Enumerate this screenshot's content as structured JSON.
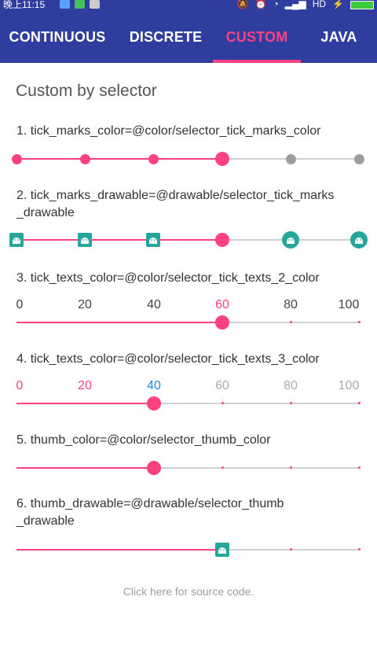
{
  "status_bar": {
    "time": "晚上11:15",
    "network": "HD"
  },
  "tabs": [
    {
      "label": "CONTINUOUS"
    },
    {
      "label": "DISCRETE"
    },
    {
      "label": "CUSTOM",
      "active": true
    },
    {
      "label": "JAVA"
    }
  ],
  "heading": "Custom by selector",
  "rows": [
    {
      "title": "1. tick_marks_color=@color/selector_tick_marks_color",
      "progress": 60
    },
    {
      "title_line1": "2. tick_marks_drawable=@drawable/selector_tick_marks",
      "title_line2": "_drawable",
      "progress": 60
    },
    {
      "title": "3. tick_texts_color=@color/selector_tick_texts_2_color",
      "ticks": [
        "0",
        "20",
        "40",
        "60",
        "80",
        "100"
      ],
      "progress": 60
    },
    {
      "title": "4. tick_texts_color=@color/selector_tick_texts_3_color",
      "ticks": [
        "0",
        "20",
        "40",
        "60",
        "80",
        "100"
      ],
      "progress": 40
    },
    {
      "title": "5. thumb_color=@color/selector_thumb_color",
      "progress": 40
    },
    {
      "title_line1": "6. thumb_drawable=@drawable/selector_thumb",
      "title_line2": "_drawable",
      "progress": 60
    }
  ],
  "footer": "Click here for source code.",
  "colors": {
    "primary": "#2f3e9e",
    "accent": "#ff4081",
    "teal": "#26a69a",
    "tick_blue": "#1e88e5",
    "inactive": "#d0d0d0"
  }
}
